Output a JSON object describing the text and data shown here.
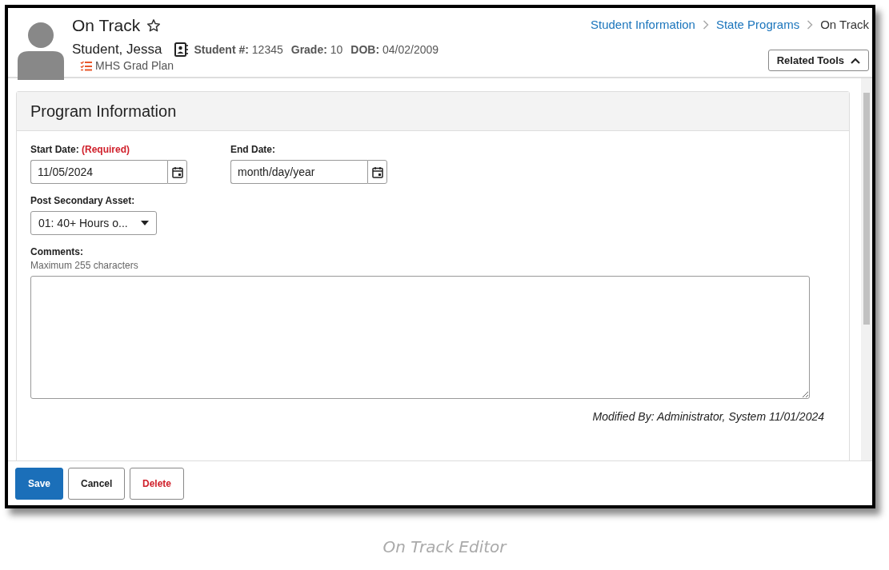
{
  "header": {
    "title": "On Track",
    "student_name": "Student, Jessa",
    "fields": [
      {
        "label": "Student #:",
        "value": "12345"
      },
      {
        "label": "Grade:",
        "value": "10"
      },
      {
        "label": "DOB:",
        "value": "04/02/2009"
      }
    ],
    "plan": "MHS Grad Plan"
  },
  "breadcrumb": [
    {
      "label": "Student Information",
      "kind": "link"
    },
    {
      "label": "State Programs",
      "kind": "link"
    },
    {
      "label": "On Track",
      "kind": "current"
    }
  ],
  "related_tools": {
    "label": "Related Tools",
    "expanded": true
  },
  "panel": {
    "title": "Program Information",
    "start_date": {
      "label": "Start Date:",
      "required": "(Required)",
      "value": "11/05/2024"
    },
    "end_date": {
      "label": "End Date:",
      "placeholder": "month/day/year"
    },
    "asset": {
      "label": "Post Secondary Asset:",
      "value": "01: 40+ Hours o..."
    },
    "comments": {
      "label": "Comments:",
      "hint": "Maximum 255 characters"
    },
    "modified": "Modified By: Administrator, System 11/01/2024"
  },
  "buttons": [
    {
      "label": "Save",
      "kind": "primary"
    },
    {
      "label": "Cancel",
      "kind": "default"
    },
    {
      "label": "Delete",
      "kind": "danger"
    }
  ],
  "caption": "On Track Editor"
}
